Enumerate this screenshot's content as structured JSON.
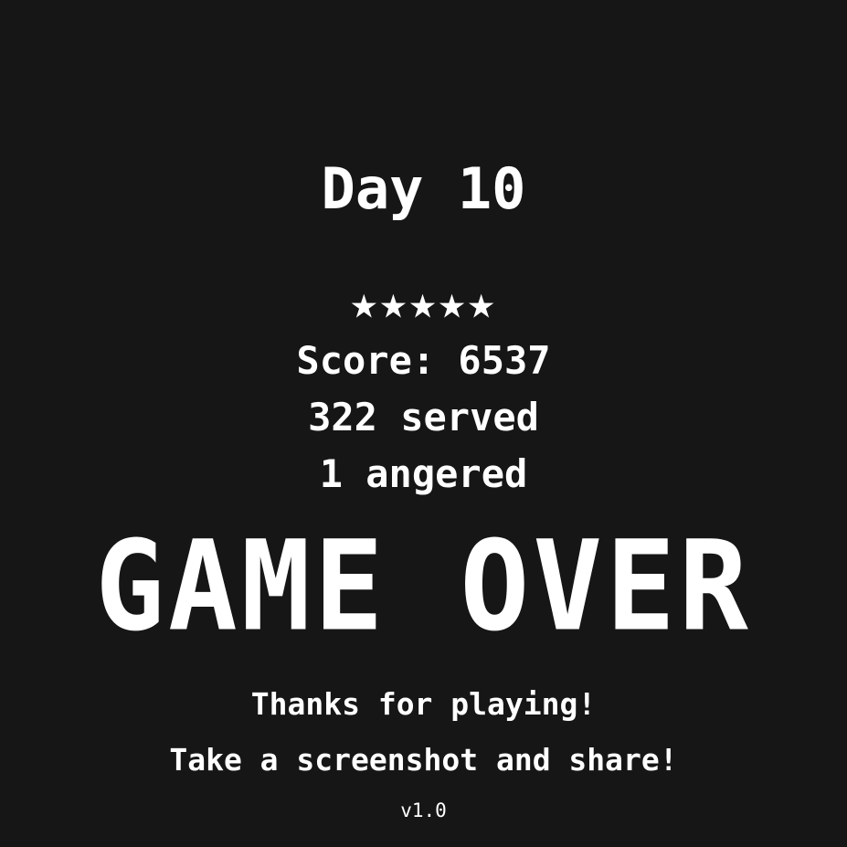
{
  "results": {
    "day": "Day 10",
    "star_rating": 5,
    "star_rating_max": 5,
    "star_glyph": "★",
    "score": "Score: 6537",
    "served": "322 served",
    "angered": "1 angered"
  },
  "status": {
    "game_over": "GAME OVER"
  },
  "footer": {
    "thanks": "Thanks for playing!",
    "share_prompt": "Take a screenshot and share!",
    "version": "v1.0"
  },
  "colors": {
    "background": "#171617",
    "text": "#ffffff"
  }
}
